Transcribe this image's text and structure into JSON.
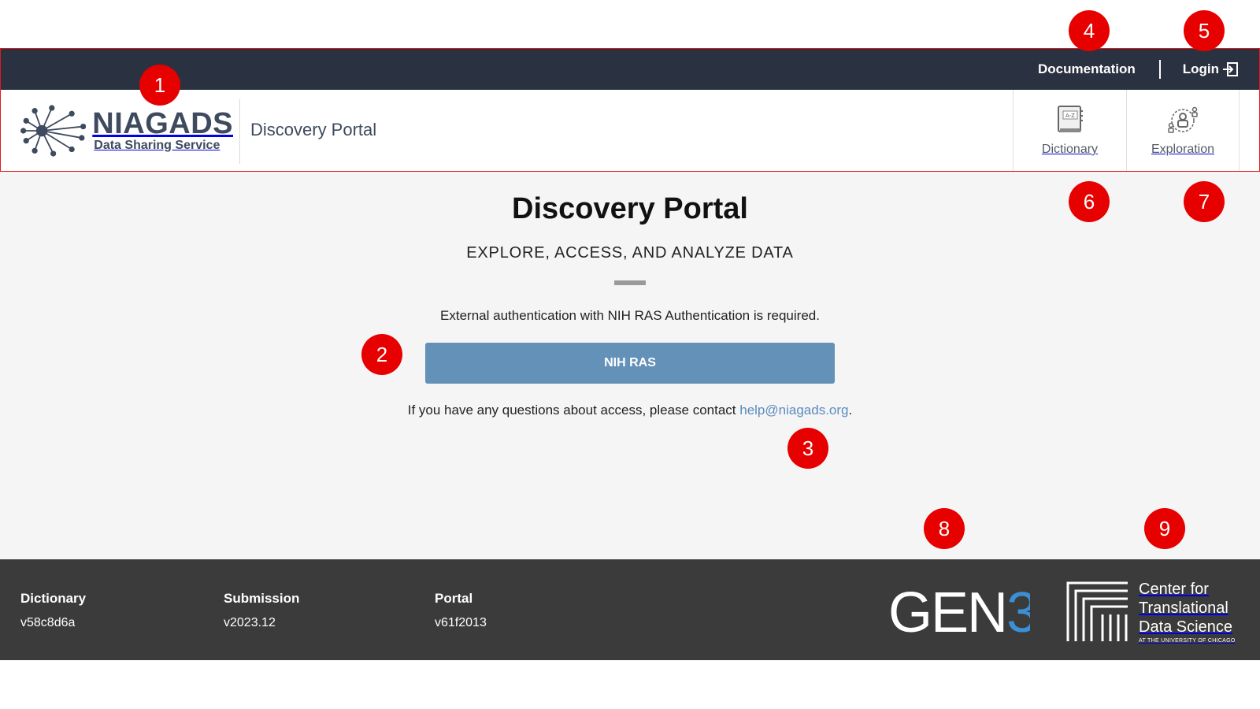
{
  "topbar": {
    "documentation_label": "Documentation",
    "login_label": "Login"
  },
  "header": {
    "logo_title": "NIAGADS",
    "logo_subtitle": "Data Sharing Service",
    "portal_name": "Discovery Portal",
    "nav": [
      {
        "label": "Dictionary",
        "icon": "dictionary-book-icon"
      },
      {
        "label": "Exploration",
        "icon": "exploration-people-icon"
      }
    ]
  },
  "main": {
    "title": "Discovery Portal",
    "subtitle": "EXPLORE, ACCESS, AND ANALYZE DATA",
    "auth_text": "External authentication with NIH RAS Authentication is required.",
    "ras_button": "NIH RAS",
    "contact_prefix": "If you have any questions about access, please contact ",
    "contact_email": "help@niagads.org",
    "contact_suffix": "."
  },
  "footer": {
    "columns": [
      {
        "heading": "Dictionary",
        "value": "v58c8d6a"
      },
      {
        "heading": "Submission",
        "value": "v2023.12"
      },
      {
        "heading": "Portal",
        "value": "v61f2013"
      }
    ],
    "gen3_logo_text": "GEN3",
    "ctds_lines": [
      "Center for",
      "Translational",
      "Data Science"
    ],
    "ctds_small": "AT THE UNIVERSITY OF CHICAGO"
  },
  "annotations": [
    "1",
    "2",
    "3",
    "4",
    "5",
    "6",
    "7",
    "8",
    "9"
  ],
  "colors": {
    "topbar": "#2a3140",
    "ras_button": "#6491b8",
    "footer": "#3b3b3b",
    "badge": "#e60000",
    "gen3_accent": "#3b8fd6"
  }
}
